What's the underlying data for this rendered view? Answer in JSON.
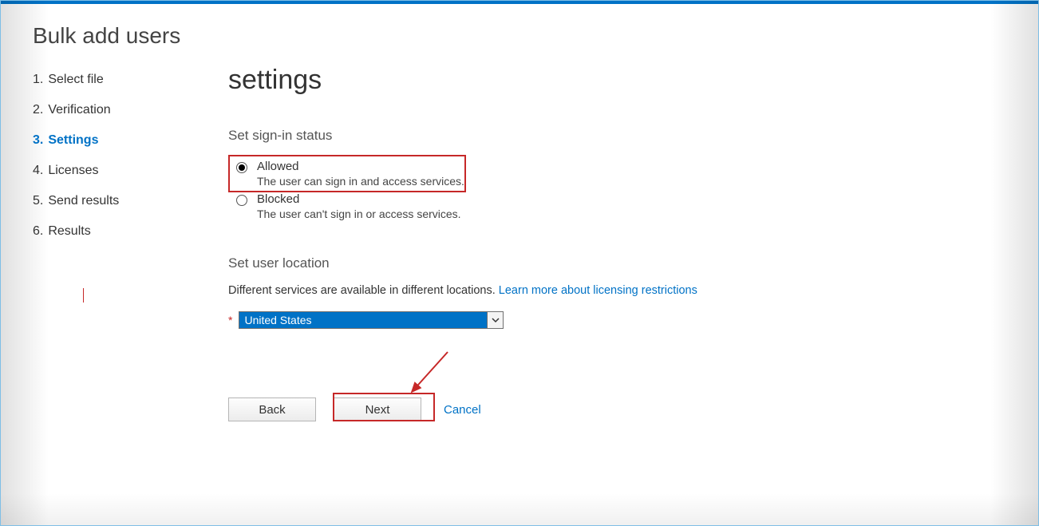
{
  "page": {
    "title": "Bulk add users",
    "content_heading": "settings"
  },
  "steps": [
    {
      "num": "1.",
      "label": "Select file"
    },
    {
      "num": "2.",
      "label": "Verification"
    },
    {
      "num": "3.",
      "label": "Settings",
      "active": true
    },
    {
      "num": "4.",
      "label": "Licenses"
    },
    {
      "num": "5.",
      "label": "Send results"
    },
    {
      "num": "6.",
      "label": "Results"
    }
  ],
  "signin": {
    "section_label": "Set sign-in status",
    "options": [
      {
        "label": "Allowed",
        "description": "The user can sign in and access services.",
        "checked": true
      },
      {
        "label": "Blocked",
        "description": "The user can't sign in or access services.",
        "checked": false
      }
    ]
  },
  "location": {
    "section_label": "Set user location",
    "note_text": "Different services are available in different locations. ",
    "note_link": "Learn more about licensing restrictions",
    "required_marker": "*",
    "selected": "United States"
  },
  "actions": {
    "back": "Back",
    "next": "Next",
    "cancel": "Cancel"
  }
}
